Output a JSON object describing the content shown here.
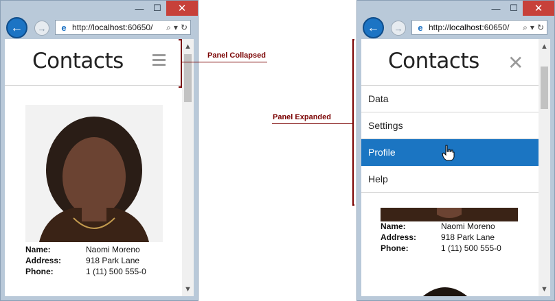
{
  "browser": {
    "url_prefix": "http://",
    "url_host": "localhost",
    "url_rest": ":60650/",
    "min_glyph": "—",
    "max_glyph": "☐",
    "close_glyph": "✕",
    "back_glyph": "←",
    "fwd_glyph": "→",
    "ie_glyph": "e",
    "search_glyph": "⌕",
    "dropdown_glyph": "▾",
    "refresh_glyph": "↻"
  },
  "app": {
    "title": "Contacts",
    "close_glyph": "✕"
  },
  "menu": {
    "items": [
      "Data",
      "Settings",
      "Profile",
      "Help"
    ],
    "active_index": 2
  },
  "contact": {
    "name_label": "Name:",
    "name": "Naomi Moreno",
    "address_label": "Address:",
    "address": "918 Park Lane",
    "phone_label": "Phone:",
    "phone": "1 (11) 500 555-0"
  },
  "scroll": {
    "up_glyph": "▲",
    "down_glyph": "▼"
  },
  "annotations": {
    "collapsed": "Panel Collapsed",
    "expanded": "Panel Expanded"
  },
  "colors": {
    "accent": "#1b75c2",
    "annotation": "#7a0000",
    "close_button": "#c7413a"
  }
}
